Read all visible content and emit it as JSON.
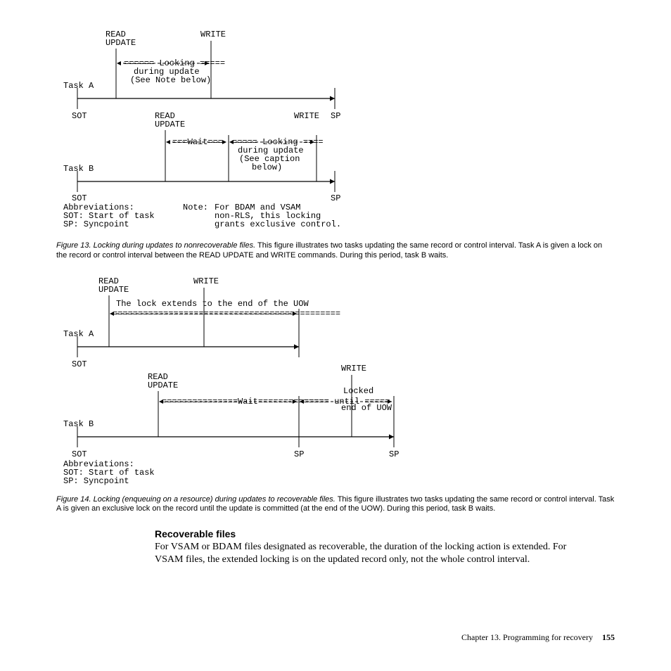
{
  "fig13": {
    "labels": {
      "read_update": "READ\nUPDATE",
      "write": "WRITE",
      "locking": "======  Locking  =====",
      "during_update": "during update",
      "see_note": "(See Note below)",
      "taskA": "Task A",
      "sot": "SOT",
      "wait": "===Wait===",
      "locking2": "=====  Locking  ====",
      "see_caption": "(See caption",
      "below": "below)",
      "taskB": "Task B",
      "sp": "SP",
      "abbrev_title": "Abbreviations:",
      "abbrev_sot": "SOT:  Start of task",
      "abbrev_sp": "SP:   Syncpoint",
      "note_label": "Note:",
      "note_l1": "For BDAM and VSAM",
      "note_l2": "non-RLS, this locking",
      "note_l3": "grants exclusive control."
    },
    "caption_label": "Figure 13. Locking during updates to nonrecoverable files.",
    "caption_body": " This figure illustrates two tasks updating the same record or control interval. Task A is given a lock on the record or control interval between the READ UPDATE and WRITE commands. During this period, task B waits."
  },
  "fig14": {
    "labels": {
      "read_update": "READ\nUPDATE",
      "write": "WRITE",
      "lock_extends": "The lock extends to the end of the UOW",
      "dashes1": "=============================================",
      "taskA": "Task A",
      "sot": "SOT",
      "wait": "===============Wait==============",
      "locked": "Locked",
      "locked2": "=====  until  =====",
      "enduow": "end of UOW",
      "taskB": "Task B",
      "sp": "SP",
      "abbrev_title": "Abbreviations:",
      "abbrev_sot": "SOT:  Start of task",
      "abbrev_sp": "SP:   Syncpoint"
    },
    "caption_label": "Figure 14. Locking (enqueuing on a resource) during updates to recoverable files.",
    "caption_body": " This figure illustrates two tasks updating the same record or control interval. Task A is given an exclusive lock on the record until the update is committed (at the end of the UOW). During this period, task B waits."
  },
  "section": {
    "heading": "Recoverable files",
    "para": "For VSAM or BDAM files designated as recoverable, the duration of the locking action is extended. For VSAM files, the extended locking is on the updated record only, not the whole control interval."
  },
  "footer": {
    "text": "Chapter 13. Programming for recovery",
    "page": "155"
  }
}
